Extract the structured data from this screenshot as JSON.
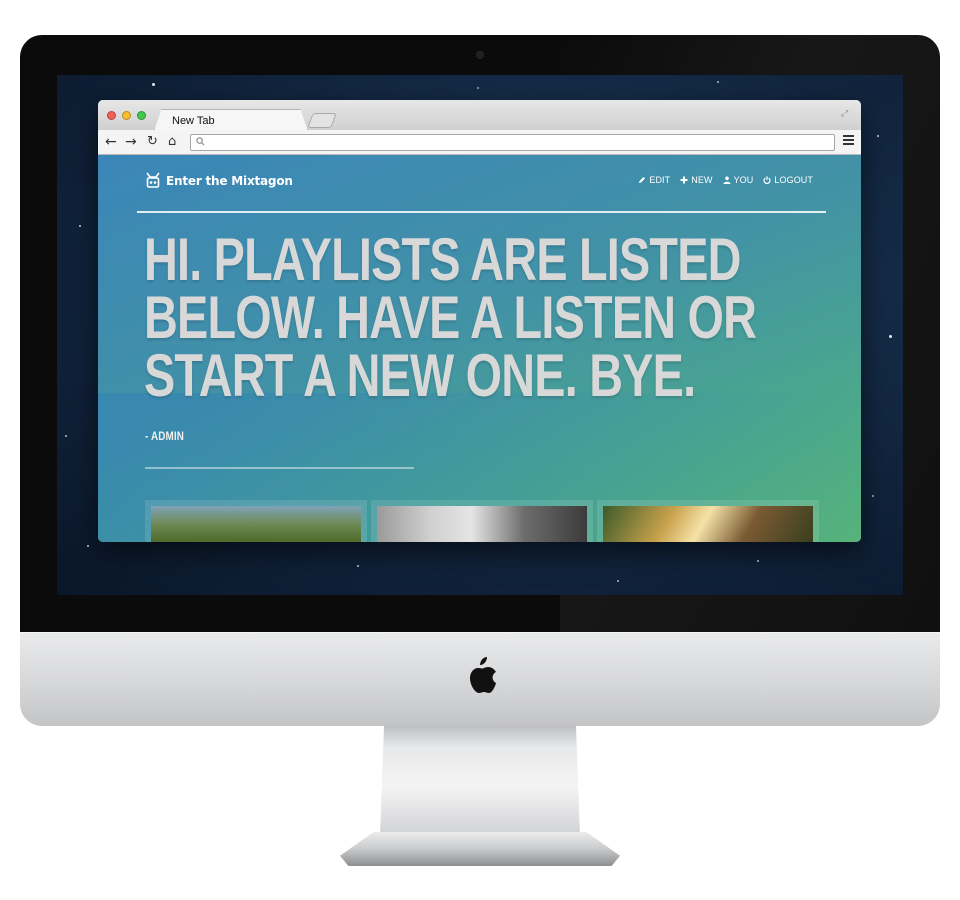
{
  "browser": {
    "tab_title": "New Tab",
    "address": ""
  },
  "site": {
    "brand": "Enter the Mixtagon",
    "nav": [
      {
        "label": "EDIT",
        "icon": "pencil-icon"
      },
      {
        "label": "NEW",
        "icon": "plus-icon"
      },
      {
        "label": "YOU",
        "icon": "user-icon"
      },
      {
        "label": "LOGOUT",
        "icon": "power-icon"
      }
    ],
    "hero_lines": [
      "HI. PLAYLISTS ARE LISTED",
      "BELOW. HAVE A LISTEN OR",
      "START A NEW ONE. BYE."
    ],
    "attribution": "- ADMIN",
    "playlist_cards": [
      {
        "image": "forest-photo"
      },
      {
        "image": "city-photo"
      },
      {
        "image": "sunset-photo"
      }
    ]
  },
  "colors": {
    "page_gradient_start": "#3b86b8",
    "page_gradient_end": "#56b37a",
    "hero_text": "#d8d8d8"
  }
}
